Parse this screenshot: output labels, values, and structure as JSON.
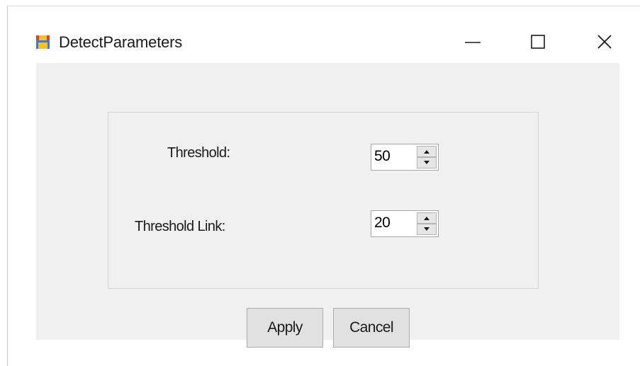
{
  "window": {
    "title": "DetectParameters",
    "app_icon": "floppy-disk-icon",
    "controls": {
      "minimize_icon": "minimize-icon",
      "maximize_icon": "maximize-icon",
      "close_icon": "close-icon"
    }
  },
  "form": {
    "fields": [
      {
        "label": "Threshold:",
        "value": "50"
      },
      {
        "label": "Threshold Link:",
        "value": "20"
      }
    ]
  },
  "buttons": {
    "apply_label": "Apply",
    "cancel_label": "Cancel"
  },
  "colors": {
    "client_background": "#f0f0f0",
    "button_face": "#e1e1e1",
    "icon_red": "#d9452b",
    "icon_blue": "#3b78d8",
    "icon_yellow": "#f2c12e"
  }
}
